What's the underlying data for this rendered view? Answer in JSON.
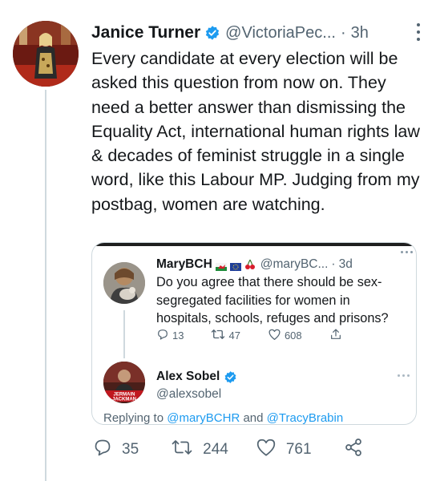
{
  "tweet": {
    "author_name": "Janice Turner",
    "author_handle": "@VictoriaPec...",
    "separator": "·",
    "time": "3h",
    "text": "Every candidate at every election will be asked this question from now on. They need a better answer than dismissing the Equality Act, international human rights law & decades of feminist struggle in a single word, like this Labour MP. Judging from my postbag, women are watching.",
    "actions": {
      "replies": "35",
      "retweets": "244",
      "likes": "761"
    }
  },
  "quoted": {
    "author_name": "MaryBCH",
    "author_handle": "@maryBC...",
    "separator": "·",
    "time": "3d",
    "text": "Do you agree that there should be sex-segregated facilities for women in hospitals, schools, refuges and prisons?",
    "actions": {
      "replies": "13",
      "retweets": "47",
      "likes": "608"
    },
    "reply": {
      "author_name": "Alex Sobel",
      "author_handle": "@alexsobel",
      "avatar_text": "JERMAIN JACKMAN",
      "replying_prefix": "Replying to",
      "mention_1": "@maryBCHR",
      "replying_and": "and",
      "mention_2": "@TracyBrabin"
    }
  },
  "colors": {
    "text": "#14171a",
    "secondary": "#536471",
    "accent": "#1d9bf0",
    "border": "#cfd9de"
  },
  "icons": [
    "verified-badge-icon",
    "more-icon",
    "reply-icon",
    "retweet-icon",
    "like-icon",
    "share-icon",
    "wales-flag-icon",
    "eu-flag-icon",
    "cherries-icon"
  ]
}
